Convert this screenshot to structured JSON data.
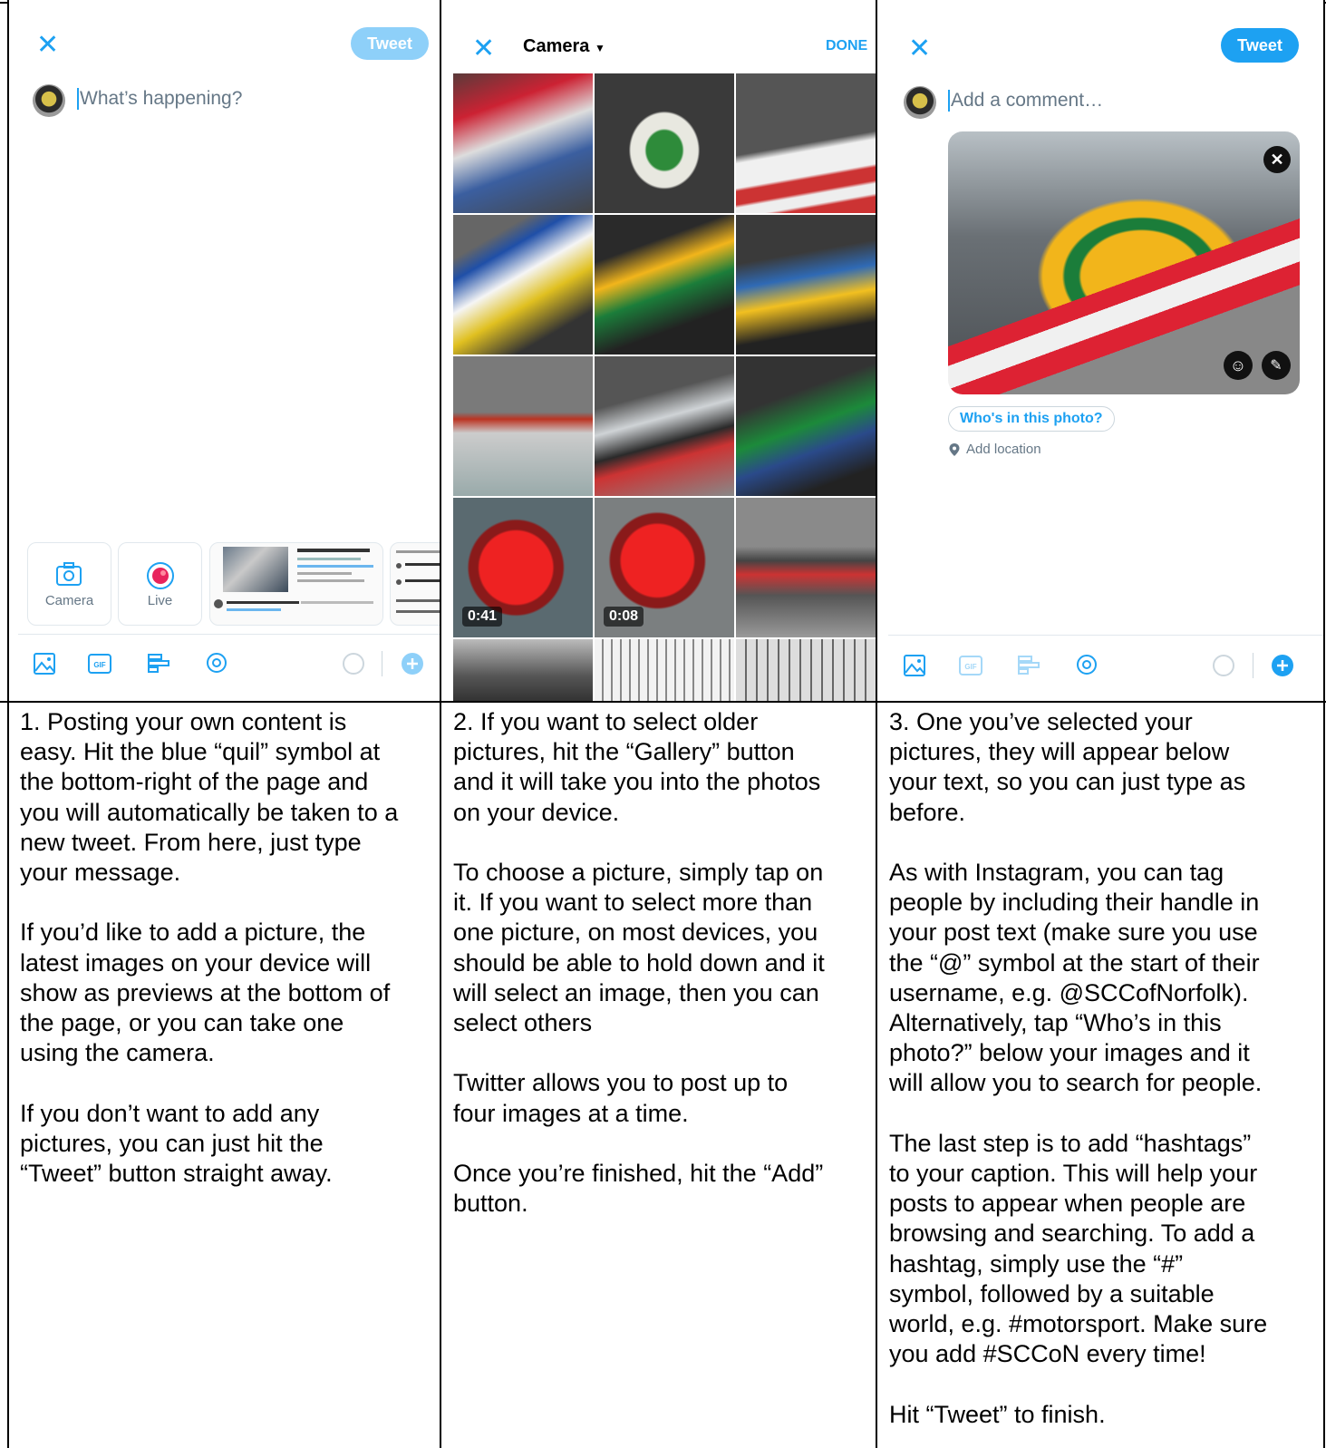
{
  "panel1": {
    "tweet_label": "Tweet",
    "placeholder": "What’s happening?",
    "camera_label": "Camera",
    "live_label": "Live",
    "toolbar_icons": [
      "image-icon",
      "gif-icon",
      "poll-icon",
      "location-icon",
      "progress-circle-icon",
      "add-tweet-icon"
    ]
  },
  "panel2": {
    "title": "Camera",
    "done_label": "DONE",
    "durations": [
      "0:41",
      "0:08"
    ]
  },
  "panel3": {
    "tweet_label": "Tweet",
    "placeholder": "Add a comment…",
    "who_label": "Who's in this photo?",
    "location_label": "Add location"
  },
  "instructions": [
    {
      "text": "1. Posting your own content is\neasy. Hit the blue “quil” symbol at\nthe bottom-right of the page and\nyou will automatically be taken to a\nnew tweet. From here, just type\nyour message.\n\nIf you’d like to add a picture, the\nlatest images on your device will\nshow as previews at the bottom of\nthe page, or you can take one\nusing the camera.\n\nIf you don’t want to add any\npictures, you can just hit the\n“Tweet” button straight away."
    },
    {
      "text": "2. If you want to select older\npictures, hit the “Gallery” button\nand it will take you into the photos\non your device.\n\nTo choose a picture, simply tap on\nit. If you want to select more than\none picture, on most devices, you\nshould be able to hold down and it\nwill select an image, then you can\nselect others\n\nTwitter allows you to post up to\nfour images at a time.\n\nOnce you’re finished, hit the “Add”\nbutton."
    },
    {
      "text": "3. One you’ve selected your\npictures, they will appear below\nyour text, so you can just type as\nbefore.\n\nAs with Instagram, you can tag\npeople by including their handle in\nyour post text (make sure you use\nthe “@” symbol at the start of their\nusername, e.g. @SCCofNorfolk).\nAlternatively, tap “Who’s in this\nphoto?” below your images and it\nwill allow you to search for people.\n\nThe last step is to add “hashtags”\nto your caption. This will help your\nposts to appear when people are\nbrowsing and searching. To add a\nhashtag, simply use the “#”\nsymbol, followed by a suitable\nworld, e.g. #motorsport. Make sure\nyou add #SCCoN every time!\n\nHit “Tweet” to finish."
    }
  ]
}
